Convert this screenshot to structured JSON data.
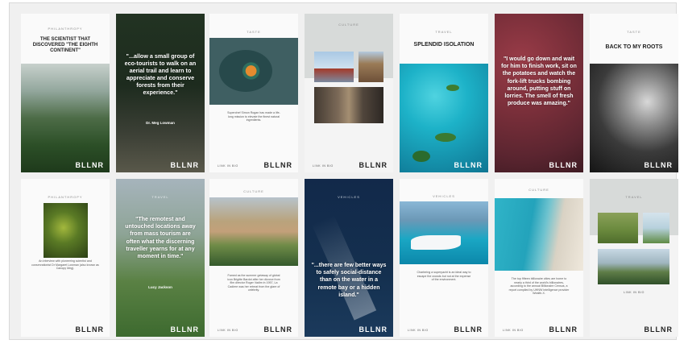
{
  "brand": "BLLNR",
  "link_in_bio": "LINK IN BIO",
  "cards_row1": {
    "c1": {
      "category": "PHILANTHROPY",
      "headline": "THE SCIENTIST THAT DISCOVERED \"THE EIGHTH CONTINENT\""
    },
    "c2": {
      "quote": "\"...allow a small group of eco-tourists to walk on an aerial trail and learn to appreciate and conserve forests from their experience.\"",
      "author": "Dr. Meg Lowman"
    },
    "c3": {
      "category": "TASTE",
      "body": "Superchef Simon Rogan has made a life-long mission to elevate the finest natural ingredients."
    },
    "c4": {
      "category": "CULTURE"
    },
    "c5": {
      "category": "TRAVEL",
      "headline": "SPLENDID ISOLATION"
    },
    "c6": {
      "quote": "\"I would go down and wait for him to finish work, sit on the potatoes and watch the fork-lift trucks bombing around, putting stuff on lorries. The smell of fresh produce was amazing.\""
    },
    "c7": {
      "category": "TASTE",
      "headline": "BACK TO MY ROOTS"
    }
  },
  "cards_row2": {
    "c1": {
      "category": "PHILANTHROPY",
      "body": "An interview with pioneering scientist and conservationist Dr Margaret Lowman (also known as Canopy Meg)."
    },
    "c2": {
      "category": "TRAVEL",
      "quote": "\"The remotest and untouched locations away from mass tourism are often what the discerning traveller yearns for at any moment in time.\"",
      "author": "Lucy Jackson"
    },
    "c3": {
      "category": "CULTURE",
      "body": "Famed as the summer getaway of global icon Brigitte Bardot after her divorce from film director Roger Vadim in 1957, La Cadiere was her retreat from the glare of celebrity."
    },
    "c4": {
      "category": "VEHICLES",
      "quote": "\"...there are few better ways to safely social-distance than on the water in a remote bay or a hidden island.\""
    },
    "c5": {
      "category": "VEHICLES",
      "body": "Chartering a superyacht is an ideal way to escape the crowds but not at the expense of the environment."
    },
    "c6": {
      "category": "CULTURE",
      "body": "The top fifteen billionaire cities are home to nearly a third of the world's billionaires, according to the annual Billionaire Census, a report compiled by UHNW intelligence provider Wealth-X."
    },
    "c7": {
      "category": "TRAVEL"
    }
  },
  "colors": {
    "forest": "#2f5a2c",
    "sea": "#1fb1c9",
    "navy": "#14304f",
    "leaf": "#7a2f3a"
  }
}
